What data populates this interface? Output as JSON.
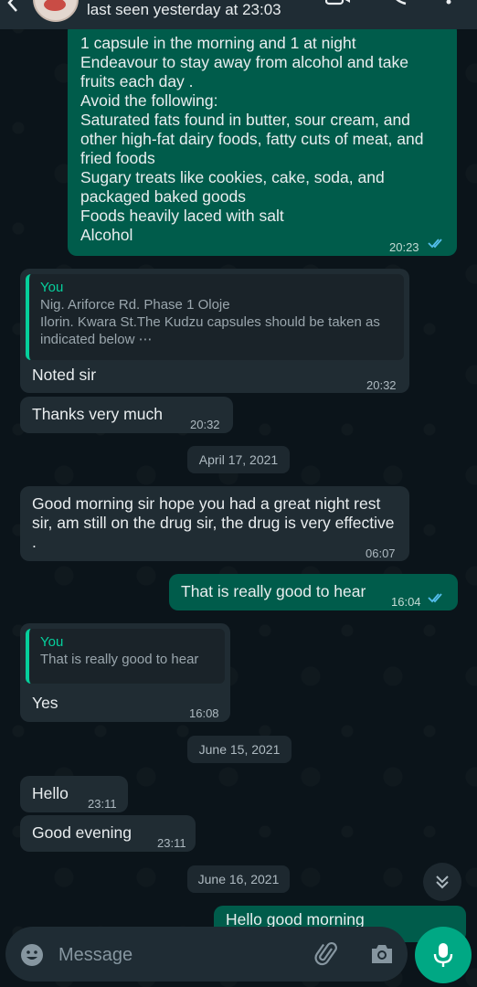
{
  "header": {
    "last_seen": "last seen yesterday at 23:03"
  },
  "messages": {
    "m1": {
      "text": "1 capsule in the morning and 1 at night\nEndeavour to stay away from alcohol and take fruits each day .\nAvoid the following:\nSaturated fats found in butter, sour cream, and other high-fat dairy foods, fatty cuts of meat, and fried foods\nSugary treats like cookies, cake, soda, and packaged baked goods\nFoods heavily laced with salt\nAlcohol",
      "time": "20:23"
    },
    "m2": {
      "quote_author": "You",
      "quote_text": "Nig. Ariforce Rd. Phase 1 Oloje\nIlorin. Kwara St.The Kudzu capsules should be taken as indicated below ⋯",
      "text": "Noted sir",
      "time": "20:32"
    },
    "m3": {
      "text": "Thanks very much",
      "time": "20:32"
    },
    "date1": "April 17, 2021",
    "m4": {
      "text": "Good morning sir hope you had a great night rest sir, am still on the drug sir, the drug is very effective .",
      "time": "06:07"
    },
    "m5": {
      "text": "That is really good to hear",
      "time": "16:04"
    },
    "m6": {
      "quote_author": "You",
      "quote_text": "That is really good to hear",
      "text": "Yes",
      "time": "16:08"
    },
    "date2": "June 15, 2021",
    "m7": {
      "text": "Hello",
      "time": "23:11"
    },
    "m8": {
      "text": "Good evening",
      "time": "23:11"
    },
    "date3": "June 16, 2021",
    "m9": {
      "text": "Hello good morning"
    }
  },
  "input": {
    "placeholder": "Message"
  },
  "colors": {
    "background": "#0b141a",
    "outgoing_bubble": "#005c4b",
    "incoming_bubble": "#202c33",
    "accent": "#00a884",
    "read_ticks": "#53bdeb"
  },
  "icons": [
    "back-arrow-icon",
    "video-call-icon",
    "voice-call-icon",
    "menu-icon",
    "double-check-icon",
    "chevron-double-down-icon",
    "emoji-icon",
    "attach-icon",
    "camera-icon",
    "mic-icon"
  ]
}
